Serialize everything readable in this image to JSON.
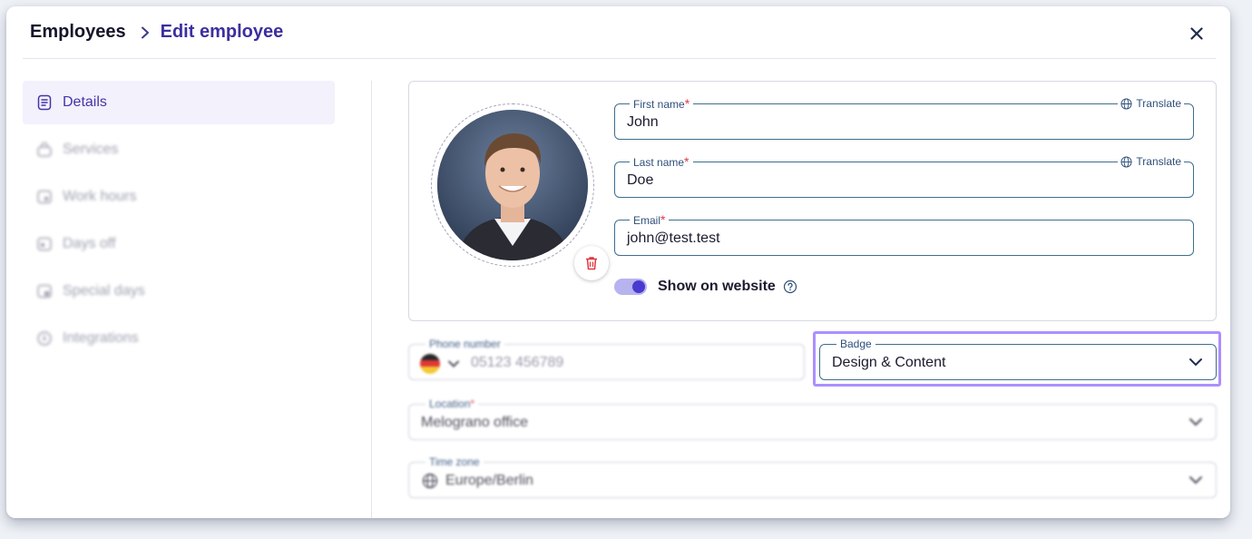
{
  "header": {
    "breadcrumb_root": "Employees",
    "breadcrumb_current": "Edit employee"
  },
  "sidebar": {
    "items": [
      {
        "label": "Details",
        "icon": "document-icon",
        "active": true
      },
      {
        "label": "Services",
        "icon": "bag-icon",
        "active": false
      },
      {
        "label": "Work hours",
        "icon": "calendar-icon",
        "active": false
      },
      {
        "label": "Days off",
        "icon": "calendar-icon",
        "active": false
      },
      {
        "label": "Special days",
        "icon": "calendar-icon",
        "active": false
      },
      {
        "label": "Integrations",
        "icon": "plug-icon",
        "active": false
      }
    ]
  },
  "profile": {
    "first_name": {
      "label": "First name",
      "value": "John",
      "translate": "Translate"
    },
    "last_name": {
      "label": "Last name",
      "value": "Doe",
      "translate": "Translate"
    },
    "email": {
      "label": "Email",
      "value": "john@test.test"
    },
    "show_on_website": {
      "label": "Show on website",
      "enabled": true
    }
  },
  "phone": {
    "label": "Phone number",
    "placeholder": "05123 456789",
    "country": "DE"
  },
  "badge": {
    "label": "Badge",
    "value": "Design & Content"
  },
  "location": {
    "label": "Location",
    "value": "Melograno office"
  },
  "timezone": {
    "label": "Time zone",
    "value": "Europe/Berlin"
  },
  "colors": {
    "accent": "#4a3bd0",
    "highlight": "#9d7bff",
    "required": "#e0383e"
  }
}
